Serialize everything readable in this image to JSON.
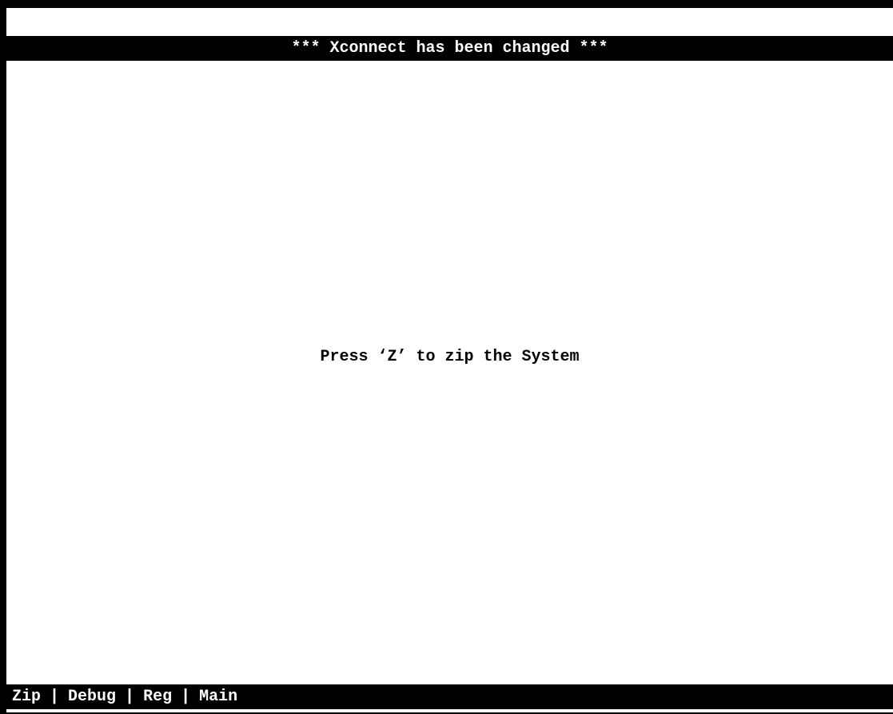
{
  "banner": {
    "text": "*** Xconnect has been changed ***"
  },
  "main": {
    "message": "Press ‘Z’ to zip the System"
  },
  "menu": {
    "items": [
      {
        "label": "Zip"
      },
      {
        "label": "Debug"
      },
      {
        "label": "Reg"
      },
      {
        "label": "Main"
      }
    ],
    "separator": "|"
  },
  "colors": {
    "background": "#ffffff",
    "bar": "#000000",
    "bar_text": "#ffffff",
    "text": "#000000"
  }
}
